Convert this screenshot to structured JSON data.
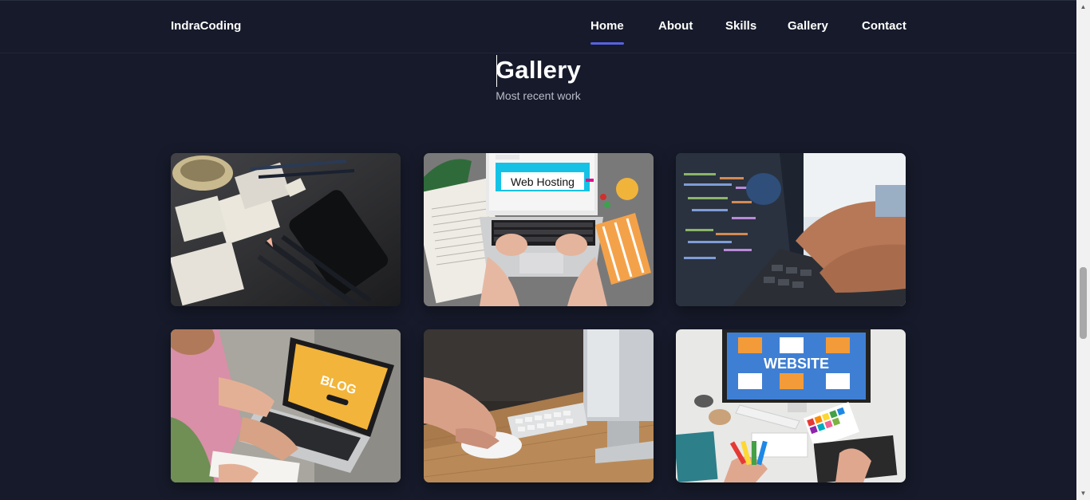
{
  "brand": {
    "name": "IndraCoding"
  },
  "nav": {
    "items": [
      {
        "label": "Home",
        "active": true
      },
      {
        "label": "About"
      },
      {
        "label": "Skills"
      },
      {
        "label": "Gallery"
      },
      {
        "label": "Contact"
      }
    ]
  },
  "gallery": {
    "title": "Gallery",
    "subtitle": "Most recent work",
    "items": [
      {
        "subject": "sketches-and-pencils-photo",
        "caption": ""
      },
      {
        "subject": "web-hosting-laptop-photo",
        "caption": "Web Hosting"
      },
      {
        "subject": "coding-laptop-photo",
        "caption": ""
      },
      {
        "subject": "blog-laptop-photo",
        "caption": "BLOG"
      },
      {
        "subject": "mouse-and-monitor-photo",
        "caption": ""
      },
      {
        "subject": "website-design-desk-photo",
        "caption": "WEBSITE"
      }
    ]
  },
  "colors": {
    "background": "#161a2a",
    "accent": "#5663e0",
    "text": "#ffffff",
    "subtext": "#b8bcc9"
  }
}
